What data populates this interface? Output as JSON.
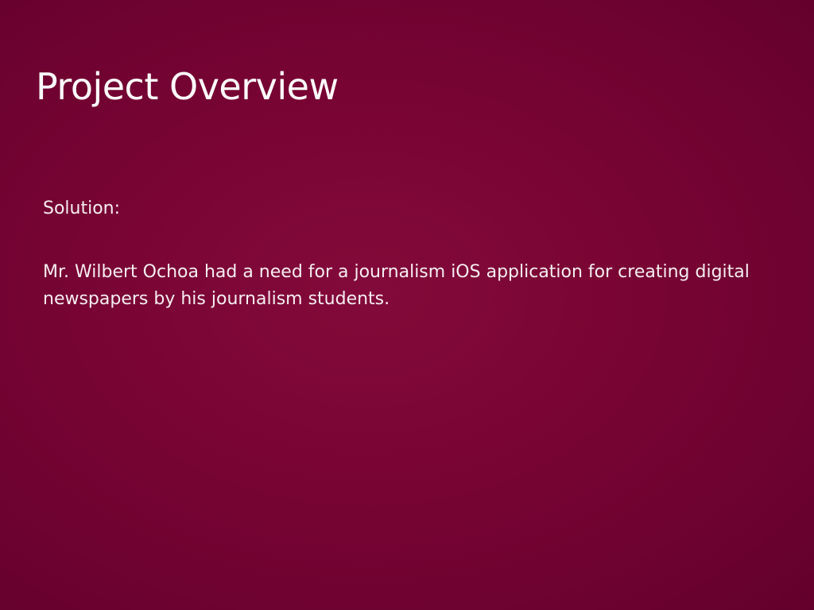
{
  "slide": {
    "title": "Project Overview",
    "paragraphs": [
      "Solution:",
      "Mr. Wilbert Ochoa had a need for a journalism iOS application for creating digital newspapers by his journalism students."
    ]
  },
  "colors": {
    "background": "#7a0534",
    "text": "#ffffff"
  }
}
